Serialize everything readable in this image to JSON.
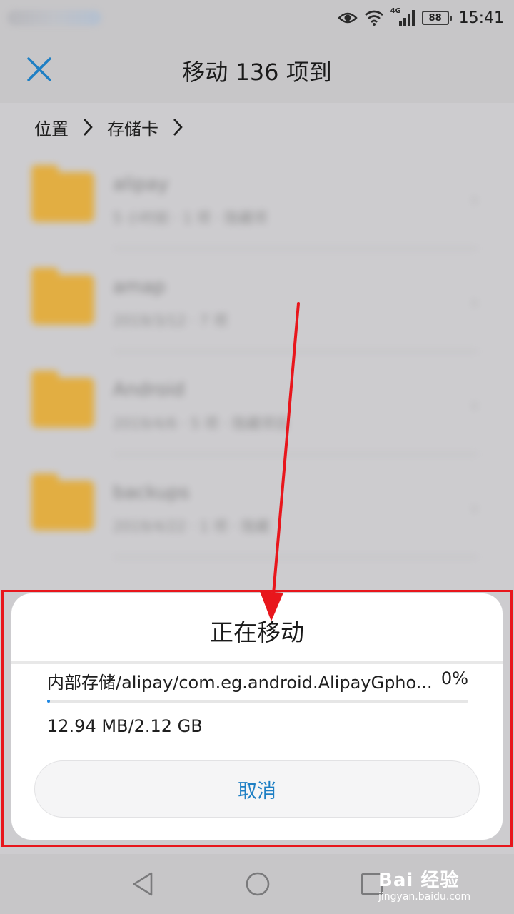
{
  "status_bar": {
    "battery": "88",
    "network": "4G",
    "time": "15:41"
  },
  "header": {
    "title": "移动 136 项到",
    "close_icon": "close-icon"
  },
  "breadcrumb": {
    "items": [
      "位置",
      "存储卡"
    ]
  },
  "file_list": [
    {
      "name": "alipay",
      "meta": "5 小时前 · 1 项 · 隐藏项"
    },
    {
      "name": "amap",
      "meta": "2019/3/12 · 7 项"
    },
    {
      "name": "Android",
      "meta": "2019/4/6 · 5 项 · 隐藏项目"
    },
    {
      "name": "backups",
      "meta": "2019/4/22 · 1 项 · 隐藏"
    }
  ],
  "dialog": {
    "title": "正在移动",
    "path": "内部存储/alipay/com.eg.android.AlipayGpho...",
    "percent": "0%",
    "progress": 0.6,
    "size": "12.94 MB/2.12 GB",
    "cancel_label": "取消"
  },
  "watermark": {
    "logo": "Bai 经验",
    "url": "jingyan.baidu.com"
  },
  "colors": {
    "accent": "#1e7fc4",
    "highlight": "#e8161c",
    "folder": "#e6a92a"
  }
}
